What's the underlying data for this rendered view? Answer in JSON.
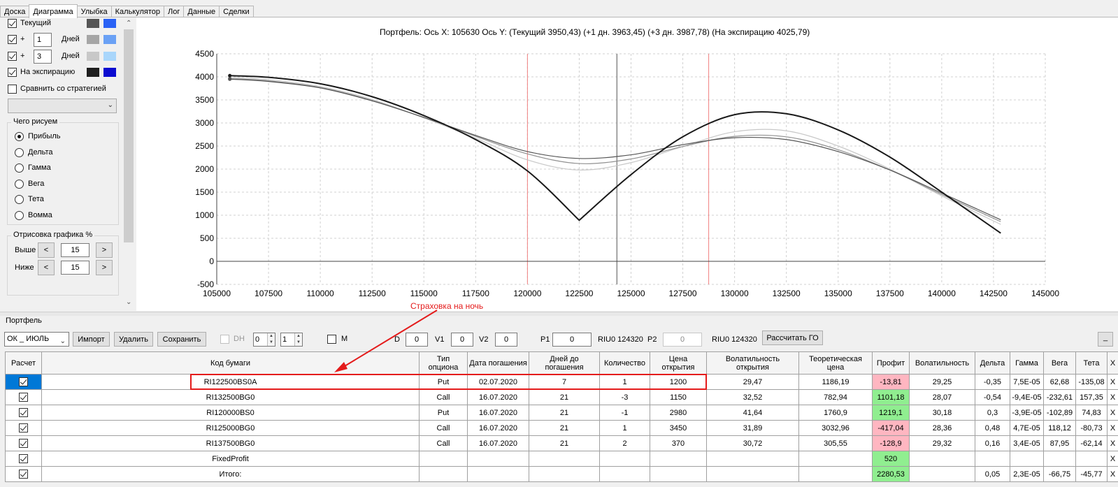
{
  "tabs": [
    "Доска",
    "Диаграмма",
    "Улыбка",
    "Калькулятор",
    "Лог",
    "Данные",
    "Сделки"
  ],
  "active_tab": "Диаграмма",
  "settings": {
    "current_label": "Текущий",
    "plus_sign": "+",
    "days_label": "Дней",
    "plus1_days": "1",
    "plus3_days": "3",
    "expiration_label": "На экспирацию",
    "compare_label": "Сравнить со стратегией",
    "series_colors": {
      "current": [
        "#555555",
        "#2a62f5"
      ],
      "plus1": [
        "#a6a6a6",
        "#6aa1f5"
      ],
      "plus3": [
        "#c8c8c8",
        "#a9d6fb"
      ],
      "expiration": [
        "#1f1f1f",
        "#0b0bd0"
      ]
    },
    "draw_group_title": "Чего рисуем",
    "draw_options": [
      "Прибыль",
      "Дельта",
      "Гамма",
      "Вега",
      "Тета",
      "Вомма"
    ],
    "draw_selected": "Прибыль",
    "render_group_title": "Отрисовка графика %",
    "above_label": "Выше",
    "below_label": "Ниже",
    "above_value": "15",
    "below_value": "15",
    "dec_label": "<",
    "inc_label": ">"
  },
  "chart": {
    "header": "Портфель: Ось X: 105630 Ось Y:  (Текущий 3950,43)  (+1 дн. 3963,45)  (+3 дн. 3987,78)  (На экспирацию 4025,79)"
  },
  "chart_data": {
    "type": "line",
    "title": "",
    "xlim": [
      105000,
      145000
    ],
    "ylim": [
      -500,
      4500
    ],
    "x_ticks": [
      "105000",
      "107500",
      "110000",
      "112500",
      "115000",
      "117500",
      "120000",
      "122500",
      "125000",
      "127500",
      "130000",
      "132500",
      "135000",
      "137500",
      "140000",
      "142500",
      "145000"
    ],
    "y_ticks": [
      "4500",
      "4000",
      "3500",
      "3000",
      "2500",
      "2000",
      "1500",
      "1000",
      "500",
      "0",
      "-500"
    ],
    "grid": true,
    "vertical_lines": [
      {
        "x": 120000,
        "color": "#f08080"
      },
      {
        "x": 124320,
        "color": "#888888"
      },
      {
        "x": 128750,
        "color": "#f08080"
      }
    ],
    "x": [
      105630,
      107500,
      110000,
      112500,
      115000,
      117500,
      120000,
      122500,
      125000,
      127500,
      130000,
      132500,
      135000,
      137500,
      140000,
      142850
    ],
    "series": [
      {
        "color": "#1a1a1a",
        "width": 2,
        "values": [
          4026,
          3990,
          3850,
          3570,
          3160,
          2640,
          1960,
          890,
          1880,
          2700,
          3180,
          3200,
          2850,
          2260,
          1500,
          610
        ]
      },
      {
        "color": "#555555",
        "width": 1.2,
        "values": [
          3950,
          3900,
          3760,
          3480,
          3120,
          2730,
          2380,
          2230,
          2310,
          2530,
          2680,
          2640,
          2380,
          1980,
          1480,
          900
        ]
      },
      {
        "color": "#909090",
        "width": 1.2,
        "values": [
          3963,
          3915,
          3770,
          3490,
          3120,
          2710,
          2330,
          2120,
          2220,
          2490,
          2710,
          2700,
          2420,
          1980,
          1450,
          860
        ]
      },
      {
        "color": "#c8c8c8",
        "width": 1.2,
        "values": [
          3988,
          3940,
          3790,
          3510,
          3110,
          2670,
          2200,
          1980,
          2140,
          2490,
          2810,
          2830,
          2500,
          2000,
          1420,
          800
        ]
      }
    ]
  },
  "portfolio": {
    "title": "Портфель",
    "strategy": "ОК _ ИЮЛЬ",
    "import_label": "Импорт",
    "delete_label": "Удалить",
    "save_label": "Сохранить",
    "dh_label": "DH",
    "dh_value1": "0",
    "dh_value2": "1",
    "m_label": "M",
    "d_label": "D",
    "d_value": "0",
    "v1_label": "V1",
    "v1_value": "0",
    "v2_label": "V2",
    "v2_value": "0",
    "p1_label": "P1",
    "p1_value": "0",
    "riu1": "RIU0 124320",
    "p2_label": "P2",
    "p2_value": "0",
    "riu2": "RIU0 124320",
    "calc_go_label": "Рассчитать ГО",
    "minimize_label": "_",
    "annotation": "Страховка на ночь"
  },
  "table": {
    "headers": [
      "Расчет",
      "Код бумаги",
      "Тип опциона",
      "Дата погашения",
      "Дней до погашения",
      "Количество",
      "Цена открытия",
      "Волатильность открытия",
      "Теоретическая цена",
      "Профит",
      "Волатильность",
      "Дельта",
      "Гамма",
      "Вега",
      "Тета",
      "X"
    ],
    "rows": [
      [
        "",
        "RI122500BS0A",
        "Put",
        "02.07.2020",
        "7",
        "1",
        "1200",
        "29,47",
        "1186,19",
        "-13,81",
        "29,25",
        "-0,35",
        "7,5E-05",
        "62,68",
        "-135,08",
        "X"
      ],
      [
        "",
        "RI132500BG0",
        "Call",
        "16.07.2020",
        "21",
        "-3",
        "1150",
        "32,52",
        "782,94",
        "1101,18",
        "28,07",
        "-0,54",
        "-9,4E-05",
        "-232,61",
        "157,35",
        "X"
      ],
      [
        "",
        "RI120000BS0",
        "Put",
        "16.07.2020",
        "21",
        "-1",
        "2980",
        "41,64",
        "1760,9",
        "1219,1",
        "30,18",
        "0,3",
        "-3,9E-05",
        "-102,89",
        "74,83",
        "X"
      ],
      [
        "",
        "RI125000BG0",
        "Call",
        "16.07.2020",
        "21",
        "1",
        "3450",
        "31,89",
        "3032,96",
        "-417,04",
        "28,36",
        "0,48",
        "4,7E-05",
        "118,12",
        "-80,73",
        "X"
      ],
      [
        "",
        "RI137500BG0",
        "Call",
        "16.07.2020",
        "21",
        "2",
        "370",
        "30,72",
        "305,55",
        "-128,9",
        "29,32",
        "0,16",
        "3,4E-05",
        "87,95",
        "-62,14",
        "X"
      ],
      [
        "",
        "FixedProfit",
        "",
        "",
        "",
        "",
        "",
        "",
        "",
        "520",
        "",
        "",
        "",
        "",
        "",
        "X"
      ],
      [
        "",
        "Итого:",
        "",
        "",
        "",
        "",
        "",
        "",
        "",
        "2280,53",
        "",
        "0,05",
        "2,3E-05",
        "-66,75",
        "-45,77",
        "X"
      ]
    ],
    "profit_colors": [
      "red",
      "green",
      "green",
      "red",
      "red",
      "green",
      "green"
    ]
  }
}
